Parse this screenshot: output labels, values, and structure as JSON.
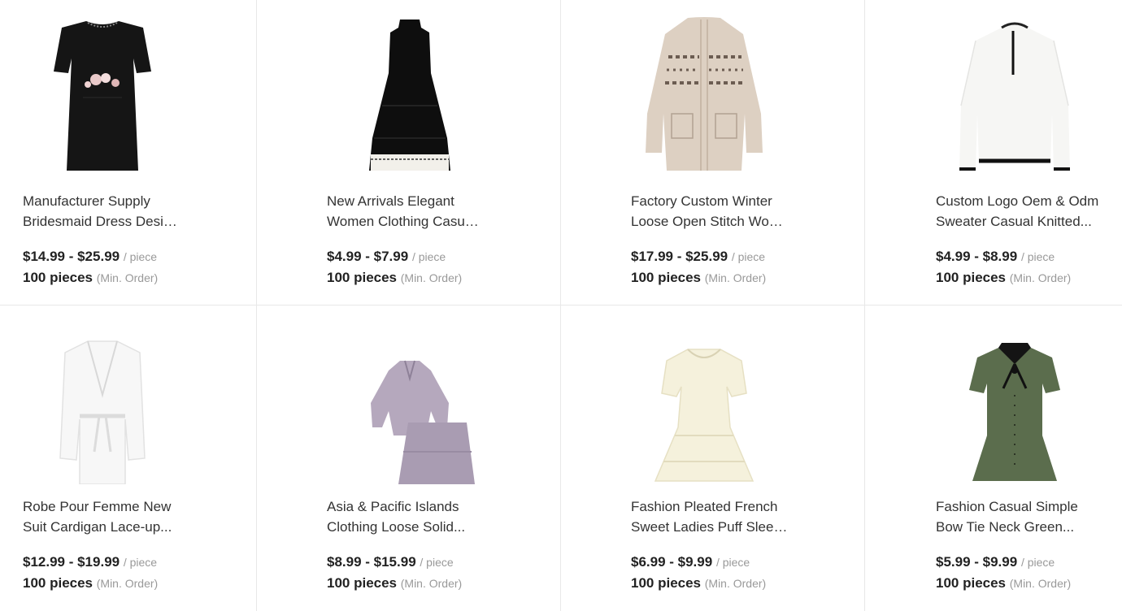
{
  "products": [
    {
      "title_line1": "Manufacturer Supply",
      "title_line2": "Bridesmaid Dress Desig...",
      "price": "$14.99 - $25.99",
      "unit": "/ piece",
      "moq": "100 pieces",
      "moq_note": "(Min. Order)",
      "image_icon": "black-dress-with-floral-belt"
    },
    {
      "title_line1": "New Arrivals Elegant",
      "title_line2": "Women Clothing Casual...",
      "price": "$4.99 - $7.99",
      "unit": "/ piece",
      "moq": "100 pieces",
      "moq_note": "(Min. Order)",
      "image_icon": "black-tiered-halter-dress"
    },
    {
      "title_line1": "Factory Custom Winter",
      "title_line2": "Loose Open Stitch Wool...",
      "price": "$17.99 - $25.99",
      "unit": "/ piece",
      "moq": "100 pieces",
      "moq_note": "(Min. Order)",
      "image_icon": "beige-knit-cardigan"
    },
    {
      "title_line1": "Custom Logo Oem & Odm",
      "title_line2": "Sweater Casual Knitted...",
      "price": "$4.99 - $8.99",
      "unit": "/ piece",
      "moq": "100 pieces",
      "moq_note": "(Min. Order)",
      "image_icon": "white-hooded-sweater"
    },
    {
      "title_line1": "Robe Pour Femme New",
      "title_line2": "Suit Cardigan Lace-up...",
      "price": "$12.99 - $19.99",
      "unit": "/ piece",
      "moq": "100 pieces",
      "moq_note": "(Min. Order)",
      "image_icon": "white-satin-robe"
    },
    {
      "title_line1": "Asia & Pacific Islands",
      "title_line2": "Clothing Loose Solid...",
      "price": "$8.99 - $15.99",
      "unit": "/ piece",
      "moq": "100 pieces",
      "moq_note": "(Min. Order)",
      "image_icon": "lavender-blouse-and-skirt-set"
    },
    {
      "title_line1": "Fashion Pleated French",
      "title_line2": "Sweet Ladies Puff Sleev...",
      "price": "$6.99 - $9.99",
      "unit": "/ piece",
      "moq": "100 pieces",
      "moq_note": "(Min. Order)",
      "image_icon": "cream-puff-sleeve-dress"
    },
    {
      "title_line1": "Fashion Casual Simple",
      "title_line2": "Bow Tie Neck Green...",
      "price": "$5.99 - $9.99",
      "unit": "/ piece",
      "moq": "100 pieces",
      "moq_note": "(Min. Order)",
      "image_icon": "green-bow-tie-dress"
    }
  ],
  "colors": {
    "border": "#e8e8e8",
    "text": "#333333",
    "muted": "#999999"
  }
}
